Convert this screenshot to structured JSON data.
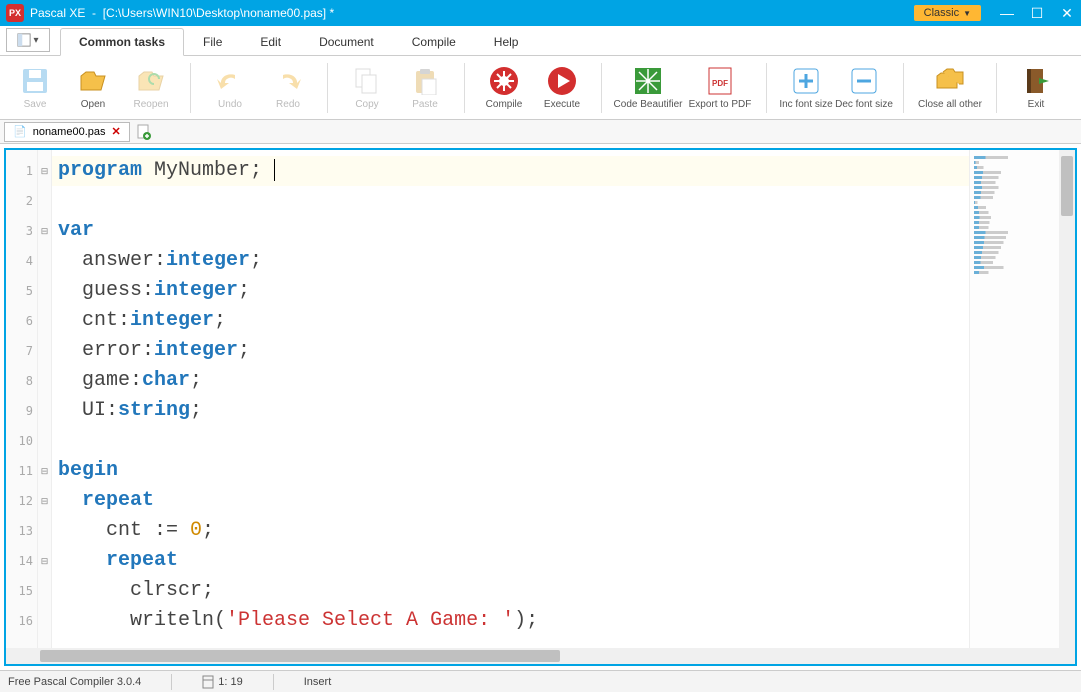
{
  "title": {
    "app": "Pascal XE",
    "path": "[C:\\Users\\WIN10\\Desktop\\noname00.pas] *"
  },
  "classic_label": "Classic",
  "menu": {
    "tabs": [
      "Common tasks",
      "File",
      "Edit",
      "Document",
      "Compile",
      "Help"
    ],
    "active_index": 0
  },
  "ribbon": {
    "save": "Save",
    "open": "Open",
    "reopen": "Reopen",
    "undo": "Undo",
    "redo": "Redo",
    "copy": "Copy",
    "paste": "Paste",
    "compile": "Compile",
    "execute": "Execute",
    "beautifier": "Code Beautifier",
    "export_pdf": "Export to PDF",
    "inc_font": "Inc font size",
    "dec_font": "Dec font size",
    "close_other": "Close all other",
    "exit": "Exit"
  },
  "open_file_tab": {
    "name": "noname00.pas"
  },
  "code": {
    "lines": [
      {
        "n": 1,
        "fold": "⊟",
        "tokens": [
          {
            "t": "program ",
            "c": "kw"
          },
          {
            "t": "MyNumber;",
            "c": "ident"
          }
        ],
        "caret_after": true,
        "highlight": true
      },
      {
        "n": 2,
        "fold": "",
        "tokens": []
      },
      {
        "n": 3,
        "fold": "⊟",
        "tokens": [
          {
            "t": "var",
            "c": "kw"
          }
        ]
      },
      {
        "n": 4,
        "fold": "",
        "tokens": [
          {
            "t": "  answer:",
            "c": "ident"
          },
          {
            "t": "integer",
            "c": "type"
          },
          {
            "t": ";",
            "c": "ident"
          }
        ]
      },
      {
        "n": 5,
        "fold": "",
        "tokens": [
          {
            "t": "  guess:",
            "c": "ident"
          },
          {
            "t": "integer",
            "c": "type"
          },
          {
            "t": ";",
            "c": "ident"
          }
        ]
      },
      {
        "n": 6,
        "fold": "",
        "tokens": [
          {
            "t": "  cnt:",
            "c": "ident"
          },
          {
            "t": "integer",
            "c": "type"
          },
          {
            "t": ";",
            "c": "ident"
          }
        ]
      },
      {
        "n": 7,
        "fold": "",
        "tokens": [
          {
            "t": "  error:",
            "c": "ident"
          },
          {
            "t": "integer",
            "c": "type"
          },
          {
            "t": ";",
            "c": "ident"
          }
        ]
      },
      {
        "n": 8,
        "fold": "",
        "tokens": [
          {
            "t": "  game:",
            "c": "ident"
          },
          {
            "t": "char",
            "c": "type"
          },
          {
            "t": ";",
            "c": "ident"
          }
        ]
      },
      {
        "n": 9,
        "fold": "",
        "tokens": [
          {
            "t": "  UI:",
            "c": "ident"
          },
          {
            "t": "string",
            "c": "type"
          },
          {
            "t": ";",
            "c": "ident"
          }
        ]
      },
      {
        "n": 10,
        "fold": "",
        "tokens": []
      },
      {
        "n": 11,
        "fold": "⊟",
        "tokens": [
          {
            "t": "begin",
            "c": "kw"
          }
        ]
      },
      {
        "n": 12,
        "fold": "⊟",
        "tokens": [
          {
            "t": "  ",
            "c": "ident"
          },
          {
            "t": "repeat",
            "c": "kw"
          }
        ]
      },
      {
        "n": 13,
        "fold": "",
        "tokens": [
          {
            "t": "    cnt := ",
            "c": "ident"
          },
          {
            "t": "0",
            "c": "num"
          },
          {
            "t": ";",
            "c": "ident"
          }
        ]
      },
      {
        "n": 14,
        "fold": "⊟",
        "tokens": [
          {
            "t": "    ",
            "c": "ident"
          },
          {
            "t": "repeat",
            "c": "kw"
          }
        ]
      },
      {
        "n": 15,
        "fold": "",
        "tokens": [
          {
            "t": "      clrscr;",
            "c": "ident"
          }
        ]
      },
      {
        "n": 16,
        "fold": "",
        "tokens": [
          {
            "t": "      writeln(",
            "c": "ident"
          },
          {
            "t": "'Please Select A Game: '",
            "c": "str"
          },
          {
            "t": ");",
            "c": "ident"
          }
        ]
      }
    ]
  },
  "status": {
    "compiler": "Free Pascal Compiler 3.0.4",
    "line_col": "1: 19",
    "mode": "Insert"
  }
}
